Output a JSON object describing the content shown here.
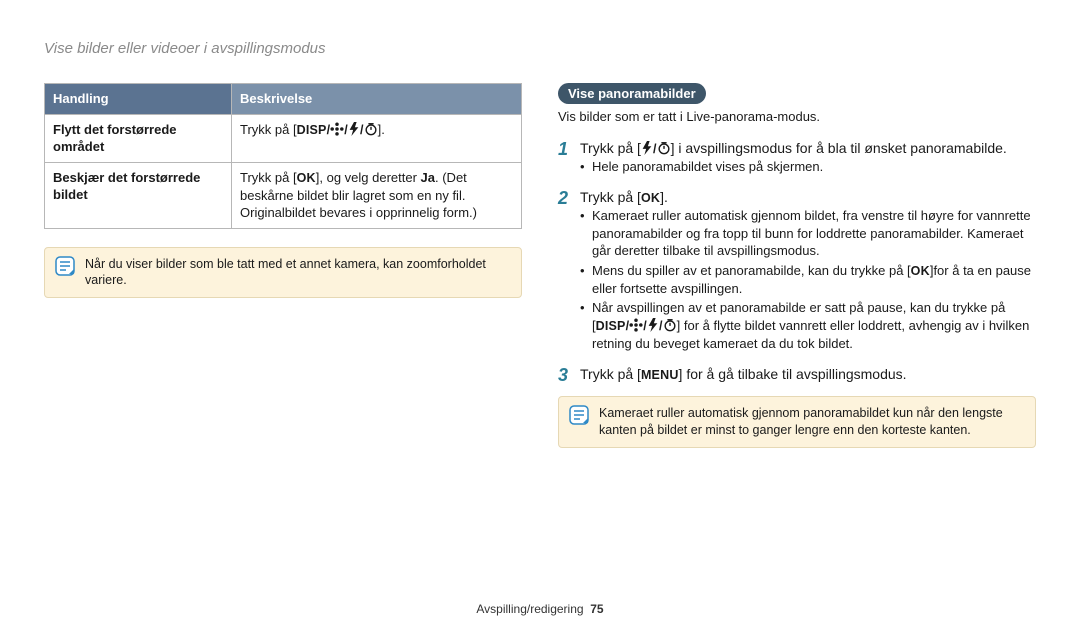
{
  "page_title": "Vise bilder eller videoer i avspillingsmodus",
  "table": {
    "head": {
      "col1": "Handling",
      "col2": "Beskrivelse"
    },
    "rows": [
      {
        "action": "Flytt det forstørrede området",
        "desc_pre": "Trykk på [",
        "desc_icons": "DISP/",
        "desc_post": "]."
      },
      {
        "action": "Beskjær det forstørrede bildet",
        "desc_pre": "Trykk på [",
        "desc_ok": "OK",
        "desc_mid": "], og velg deretter ",
        "desc_ja": "Ja",
        "desc_post": ". (Det beskårne bildet blir lagret som en ny fil. Originalbildet bevares i opprinnelig form.)"
      }
    ]
  },
  "left_note": "Når du viser bilder som ble tatt med et annet kamera, kan zoomforholdet variere.",
  "pill": "Vise panoramabilder",
  "pill_sub": "Vis bilder som er tatt i Live-panorama-modus.",
  "steps": {
    "s1": {
      "num": "1",
      "pre": "Trykk på [",
      "post": "] i avspillingsmodus for å bla til ønsket panoramabilde.",
      "b1": "Hele panoramabildet vises på skjermen."
    },
    "s2": {
      "num": "2",
      "pre": "Trykk på [",
      "ok": "OK",
      "post": "].",
      "b1": "Kameraet ruller automatisk gjennom bildet, fra venstre til høyre for vannrette panoramabilder og fra topp til bunn for loddrette panoramabilder. Kameraet går deretter tilbake til avspillingsmodus.",
      "b2_pre": "Mens du spiller av et panoramabilde, kan du trykke på [",
      "b2_ok": "OK",
      "b2_post": "]for å ta en pause eller fortsette avspillingen.",
      "b3_pre": "Når avspillingen av et panoramabilde er satt på pause, kan du trykke på [",
      "b3_disp": "DISP/",
      "b3_post": "] for å flytte bildet vannrett eller loddrett, avhengig av i hvilken retning du beveget kameraet da du tok bildet."
    },
    "s3": {
      "num": "3",
      "pre": "Trykk på [",
      "menu": "MENU",
      "post": "] for å gå tilbake til avspillingsmodus."
    }
  },
  "right_note": "Kameraet ruller automatisk gjennom panoramabildet kun når den lengste kanten på bildet er minst to ganger lengre enn den korteste kanten.",
  "footer": {
    "section": "Avspilling/redigering",
    "page": "75"
  }
}
